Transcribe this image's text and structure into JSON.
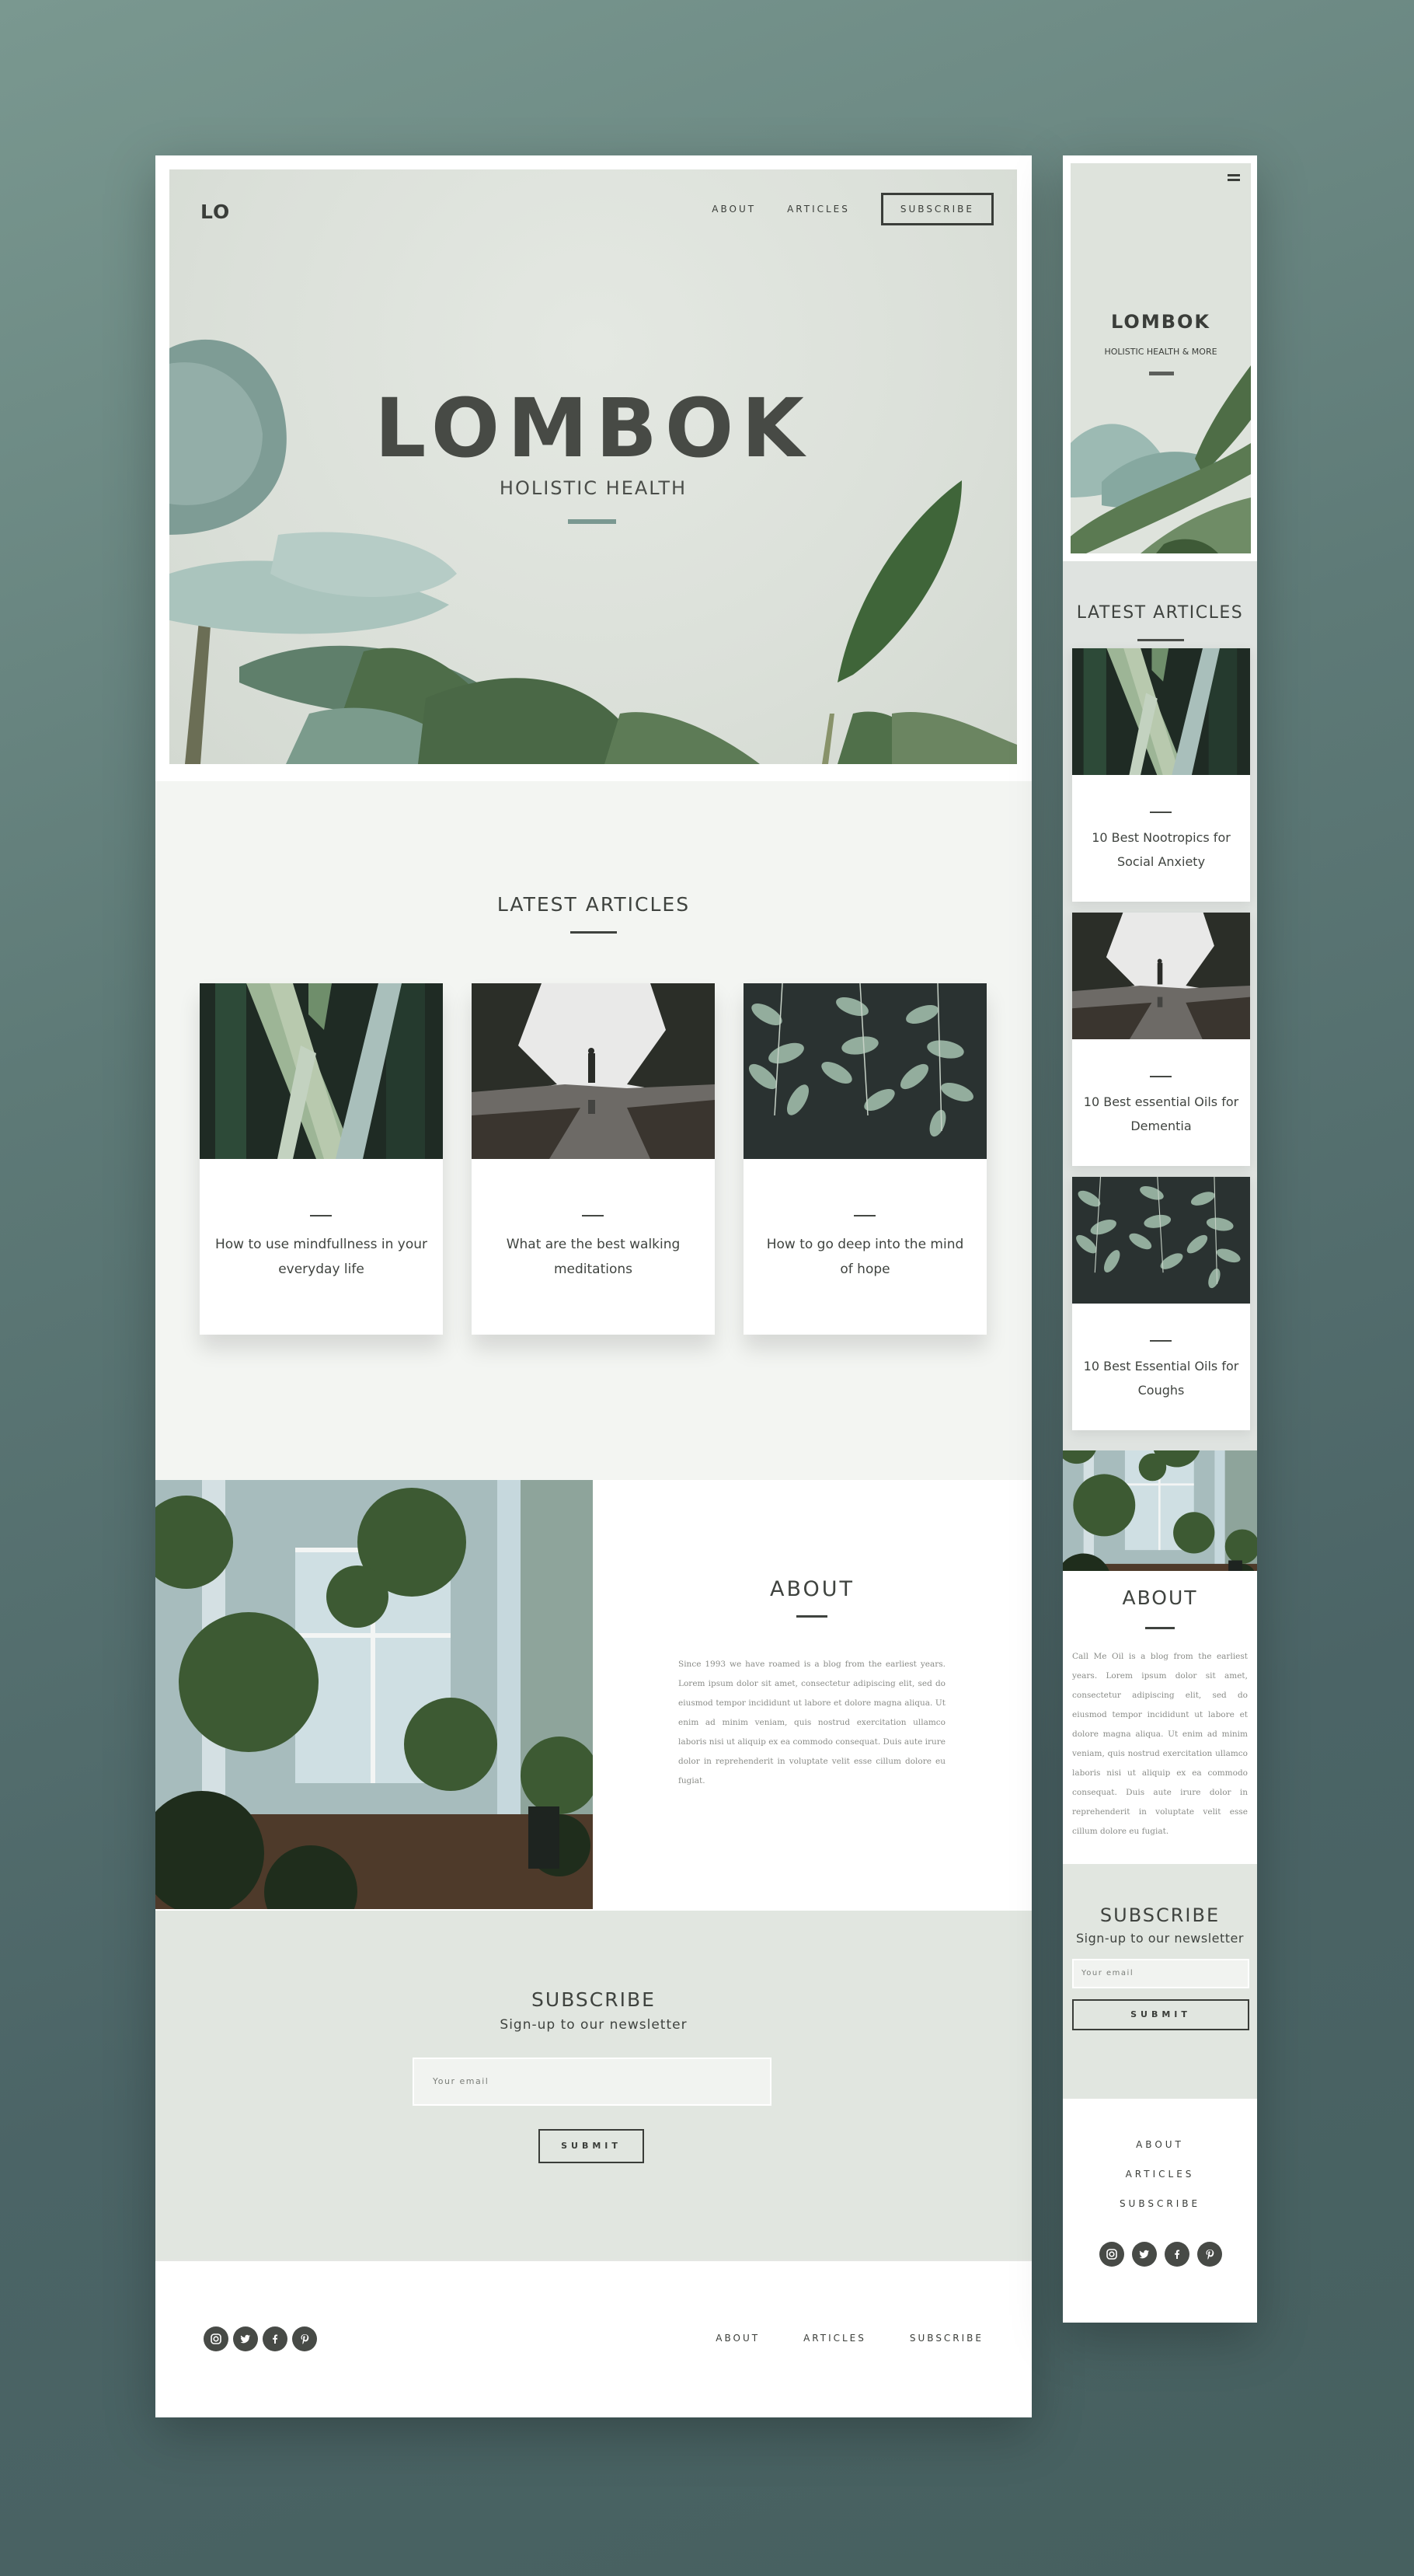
{
  "colors": {
    "background_top": "#7a9890",
    "background_bottom": "#46605f",
    "text_dark": "#3f433f",
    "accent_sage": "#7a9891",
    "subscribe_bg": "#e1e6e0",
    "latest_bg": "#f3f5f2"
  },
  "desktop": {
    "header": {
      "logo": "LO",
      "nav": [
        {
          "label": "ABOUT"
        },
        {
          "label": "ARTICLES"
        }
      ],
      "subscribe_button": "SUBSCRIBE"
    },
    "hero": {
      "title": "LOMBOK",
      "subtitle": "HOLISTIC HEALTH"
    },
    "latest": {
      "heading": "LATEST ARTICLES",
      "articles": [
        {
          "title": "How to use mindfullness in your everyday life",
          "image": "leaves-closeup"
        },
        {
          "title": "What are the best walking meditations",
          "image": "misty-lake-hiker"
        },
        {
          "title": "How to go deep into the mind of hope",
          "image": "hanging-leaves"
        }
      ]
    },
    "about": {
      "heading": "ABOUT",
      "image": "greenhouse",
      "body": "Since 1993 we have roamed is a blog from the earliest years. Lorem ipsum dolor sit amet, consectetur adipiscing elit, sed do eiusmod tempor incididunt ut labore et dolore magna aliqua. Ut enim ad minim veniam, quis nostrud exercitation ullamco laboris nisi ut aliquip ex ea commodo consequat. Duis aute irure dolor in reprehenderit in voluptate velit esse cillum dolore eu fugiat."
    },
    "subscribe": {
      "heading": "SUBSCRIBE",
      "subheading": "Sign-up to our newsletter",
      "email_placeholder": "Your email",
      "submit": "SUBMIT"
    },
    "footer": {
      "socials": [
        "instagram-icon",
        "twitter-icon",
        "facebook-icon",
        "pinterest-icon"
      ],
      "links": [
        {
          "label": "ABOUT"
        },
        {
          "label": "ARTICLES"
        },
        {
          "label": "SUBSCRIBE"
        }
      ]
    }
  },
  "mobile": {
    "menu_icon": "hamburger-icon",
    "hero": {
      "title": "LOMBOK",
      "subtitle": "HOLISTIC HEALTH & MORE"
    },
    "latest": {
      "heading": "LATEST ARTICLES",
      "articles": [
        {
          "title": "10 Best Nootropics for Social Anxiety",
          "image": "leaves-closeup"
        },
        {
          "title": "10 Best essential Oils for Dementia",
          "image": "misty-lake-hiker"
        },
        {
          "title": "10 Best Essential Oils for Coughs",
          "image": "hanging-leaves"
        }
      ]
    },
    "about": {
      "heading": "ABOUT",
      "image": "greenhouse",
      "body": "Call Me Oil is a blog from the earliest years. Lorem ipsum dolor sit amet, consectetur adipiscing elit, sed do eiusmod tempor incididunt ut labore et dolore magna aliqua. Ut enim ad minim veniam, quis nostrud exercitation ullamco laboris nisi ut aliquip ex ea commodo consequat. Duis aute irure dolor in reprehenderit in voluptate velit esse cillum dolore eu fugiat."
    },
    "subscribe": {
      "heading": "SUBSCRIBE",
      "subheading": "Sign-up to our newsletter",
      "email_placeholder": "Your email",
      "submit": "SUBMIT"
    },
    "footer": {
      "links": [
        {
          "label": "ABOUT"
        },
        {
          "label": "ARTICLES"
        },
        {
          "label": "SUBSCRIBE"
        }
      ],
      "socials": [
        "instagram-icon",
        "twitter-icon",
        "facebook-icon",
        "pinterest-icon"
      ]
    }
  }
}
